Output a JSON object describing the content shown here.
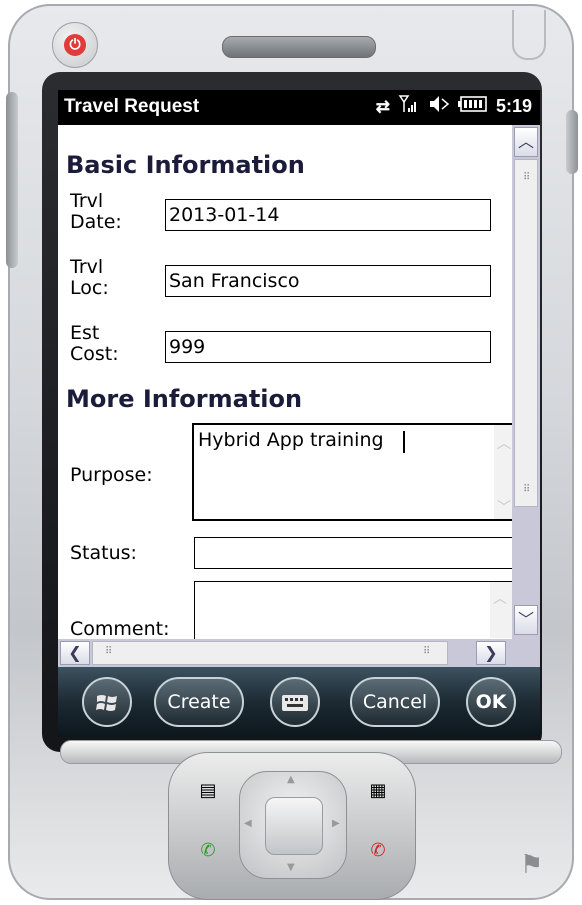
{
  "window": {
    "title": "Travel Request",
    "status": {
      "connectivity_icon": "sync-arrows-icon",
      "signal_icon": "signal-bars-icon",
      "volume_icon": "speaker-muted-icon",
      "battery_icon": "battery-icon",
      "time": "5:19"
    }
  },
  "form": {
    "basic_section_title": "Basic Information",
    "travel_date": {
      "label_line1": "Trvl",
      "label_line2": "Date:",
      "value": "2013-01-14"
    },
    "travel_location": {
      "label_line1": "Trvl",
      "label_line2": "Loc:",
      "value": "San Francisco"
    },
    "estimated_cost": {
      "label_line1": "Est",
      "label_line2": "Cost:",
      "value": "999"
    },
    "more_section_title": "More Information",
    "purpose": {
      "label": "Purpose:",
      "value": "Hybrid App training"
    },
    "status": {
      "label": "Status:",
      "value": ""
    },
    "comment": {
      "label": "Comment:",
      "value": ""
    }
  },
  "softkeys": {
    "start_icon": "windows-start-icon",
    "create_label": "Create",
    "keyboard_icon": "keyboard-icon",
    "cancel_label": "Cancel",
    "ok_label": "OK"
  },
  "hardware": {
    "power_icon": "power-icon",
    "contacts_icon": "contact-card-icon",
    "calendar_icon": "calendar-grid-icon",
    "call_icon": "call-answer-icon",
    "hangup_icon": "call-end-icon",
    "windows_logo_icon": "windows-flag-icon"
  },
  "colors": {
    "title_bar": "#000000",
    "section_title": "#1b1b3a",
    "scrollbar_track": "#c8c8d8",
    "softkey_bar": "#1c2a33"
  }
}
